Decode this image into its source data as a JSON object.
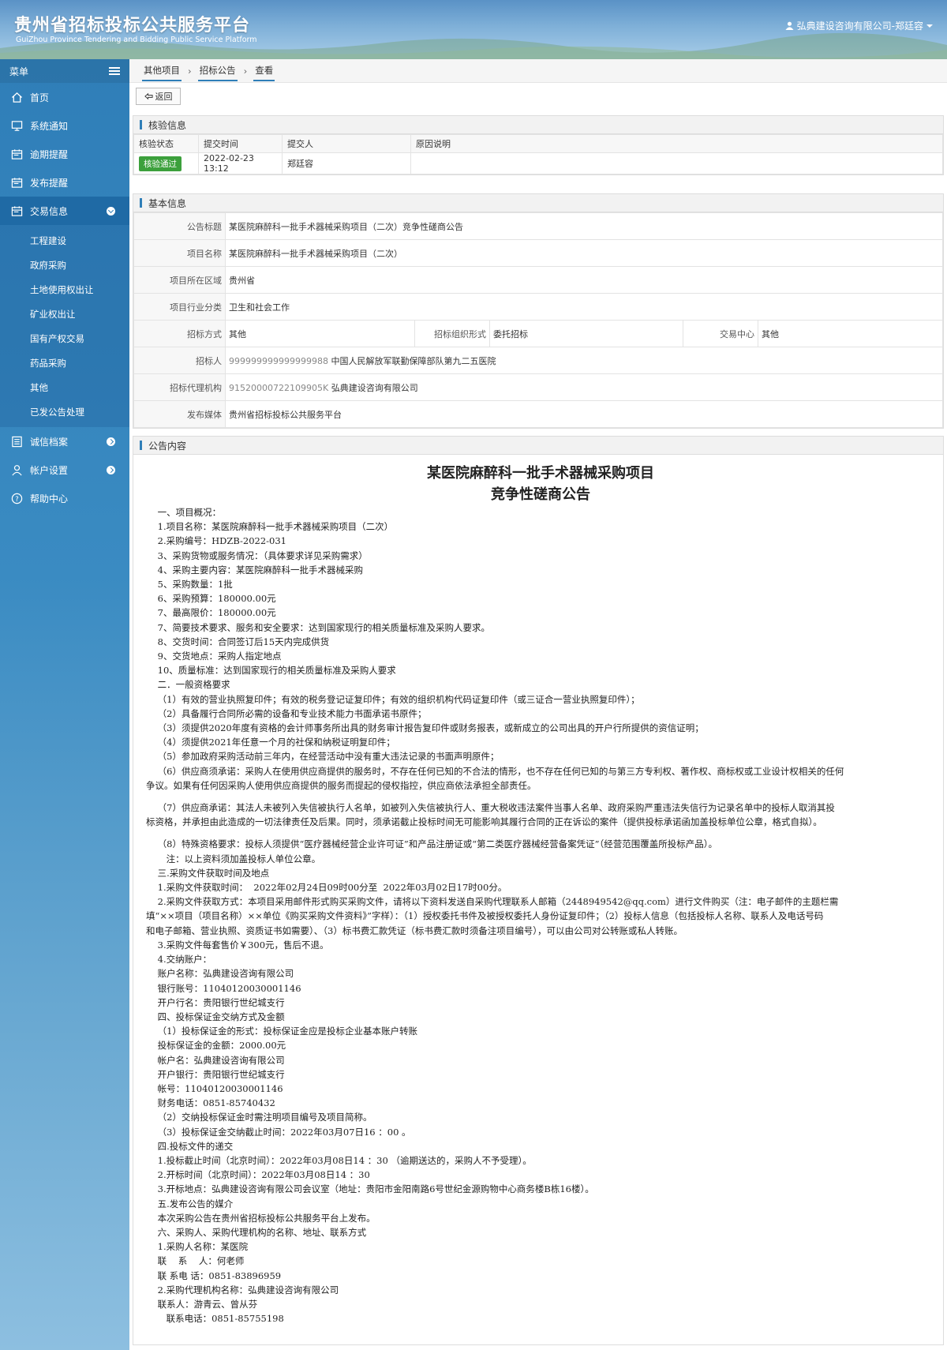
{
  "header": {
    "title_cn": "贵州省招标投标公共服务平台",
    "title_en": "GuiZhou Province Tendering and Bidding Public Service Platform",
    "user": "弘典建设咨询有限公司-郑廷容"
  },
  "sidebar": {
    "menu_label": "菜单",
    "items": [
      {
        "label": "首页"
      },
      {
        "label": "系统通知"
      },
      {
        "label": "逾期提醒"
      },
      {
        "label": "发布提醒"
      },
      {
        "label": "交易信息"
      },
      {
        "label": "诚信档案"
      },
      {
        "label": "帐户设置"
      },
      {
        "label": "帮助中心"
      }
    ],
    "sub_items": [
      "工程建设",
      "政府采购",
      "土地使用权出让",
      "矿业权出让",
      "国有产权交易",
      "药品采购",
      "其他",
      "已发公告处理"
    ]
  },
  "breadcrumb": [
    "其他项目",
    "招标公告",
    "查看"
  ],
  "back_label": "返回",
  "verify": {
    "title": "核验信息",
    "headers": [
      "核验状态",
      "提交时间",
      "提交人",
      "原因说明"
    ],
    "status": "核验通过",
    "time": "2022-02-23 13:12",
    "person": "郑廷容",
    "reason": ""
  },
  "basic": {
    "title": "基本信息",
    "rows": {
      "notice_title_label": "公告标题",
      "notice_title": "某医院麻醉科一批手术器械采购项目（二次）竞争性磋商公告",
      "project_name_label": "项目名称",
      "project_name": "某医院麻醉科一批手术器械采购项目（二次）",
      "region_label": "项目所在区域",
      "region": "贵州省",
      "industry_label": "项目行业分类",
      "industry": "卫生和社会工作",
      "method_label": "招标方式",
      "method": "其他",
      "org_form_label": "招标组织形式",
      "org_form": "委托招标",
      "center_label": "交易中心",
      "center": "其他",
      "tenderer_label": "招标人",
      "tenderer_code": "999999999999999988",
      "tenderer": "中国人民解放军联勤保障部队第九二五医院",
      "agent_label": "招标代理机构",
      "agent_code": "91520000722109905K",
      "agent": "弘典建设咨询有限公司",
      "media_label": "发布媒体",
      "media": "贵州省招标投标公共服务平台"
    }
  },
  "notice": {
    "title": "公告内容",
    "heading1": "某医院麻醉科一批手术器械采购项目",
    "heading2": "竞争性磋商公告",
    "lines": [
      "    一、项目概况：",
      "    1.项目名称：某医院麻醉科一批手术器械采购项目（二次）",
      "    2.采购编号：HDZB-2022-031",
      "    3、采购货物或服务情况：（具体要求详见采购需求）",
      "    4、采购主要内容：某医院麻醉科一批手术器械采购",
      "    5、采购数量：1批",
      "    6、采购预算：180000.00元",
      "    7、最高限价：180000.00元",
      "    7、简要技术要求、服务和安全要求：达到国家现行的相关质量标准及采购人要求。",
      "    8、交货时间：合同签订后15天内完成供货",
      "    9、交货地点：采购人指定地点",
      "    10、质量标准：达到国家现行的相关质量标准及采购人要求",
      "    二．一般资格要求",
      "    （1）有效的营业执照复印件；有效的税务登记证复印件；有效的组织机构代码证复印件（或三证合一营业执照复印件）；",
      "    （2）具备履行合同所必需的设备和专业技术能力书面承诺书原件；",
      "    （3）须提供2020年度有资格的会计师事务所出具的财务审计报告复印件或财务报表，或新成立的公司出具的开户行所提供的资信证明；",
      "    （4）须提供2021年任意一个月的社保和纳税证明复印件；",
      "    （5）参加政府采购活动前三年内，在经营活动中没有重大违法记录的书面声明原件；",
      "    （6）供应商须承诺：采购人在使用供应商提供的服务时，不存在任何已知的不合法的情形，也不存在任何已知的与第三方专利权、著作权、商标权或工业设计权相关的任何",
      "争议。如果有任何因采购人使用供应商提供的服务而提起的侵权指控，供应商依法承担全部责任。",
      "",
      "    （7）供应商承诺：其法人未被列入失信被执行人名单，如被列入失信被执行人、重大税收违法案件当事人名单、政府采购严重违法失信行为记录名单中的投标人取消其投",
      "标资格，并承担由此造成的一切法律责任及后果。同时，须承诺截止投标时间无可能影响其履行合同的正在诉讼的案件（提供投标承诺函加盖投标单位公章，格式自拟）。",
      "",
      "    （8）特殊资格要求：投标人须提供“医疗器械经营企业许可证”和产品注册证或“第二类医疗器械经营备案凭证”（经营范围覆盖所投标产品）。",
      "       注：以上资料须加盖投标人单位公章。",
      "    三.采购文件获取时间及地点",
      "    1.采购文件获取时间：  2022年02月24日09时00分至  2022年03月02日17时00分。",
      "    2.采购文件获取方式：本项目采用邮件形式购买采购文件，请将以下资料发送自采购代理联系人邮箱（2448949542@qq.com）进行文件购买（注：电子邮件的主题栏需",
      "填“××项目（项目名称）××单位《购买采购文件资料》”字样）：（1）授权委托书件及被授权委托人身份证复印件；（2）投标人信息（包括投标人名称、联系人及电话号码",
      "和电子邮箱、营业执照、资质证书如需要）、（3）标书费汇款凭证（标书费汇款时须备注项目编号），可以由公司对公转账或私人转账。",
      "    3.采购文件每套售价￥300元，售后不退。",
      "    4.交纳账户：",
      "    账户名称：弘典建设咨询有限公司",
      "    银行账号：11040120030001146",
      "    开户行名：贵阳银行世纪城支行",
      "    四、投标保证金交纳方式及金额",
      "    （1）投标保证金的形式：投标保证金应是投标企业基本账户转账",
      "    投标保证金的金额：2000.00元",
      "    帐户名：弘典建设咨询有限公司",
      "    开户银行：贵阳银行世纪城支行",
      "    帐号：11040120030001146",
      "    财务电话：0851-85740432",
      "    （2）交纳投标保证金时需注明项目编号及项目简称。",
      "    （3）投标保证金交纳截止时间：2022年03月07日16 ：00 。",
      "    四.投标文件的递交",
      "    1.投标截止时间（北京时间）：2022年03月08日14 ：30 （逾期送达的，采购人不予受理）。",
      "    2.开标时间（北京时间）：2022年03月08日14 ：30",
      "    3.开标地点：弘典建设咨询有限公司会议室（地址：贵阳市金阳南路6号世纪金源购物中心商务楼B栋16楼）。",
      "    五.发布公告的媒介",
      "    本次采购公告在贵州省招标投标公共服务平台上发布。",
      "    六、采购人、采购代理机构的名称、地址、联系方式",
      "    1.采购人名称：某医院",
      "    联    系    人：何老师",
      "    联 系电 话：0851-83896959",
      "    2.采购代理机构名称：弘典建设咨询有限公司",
      "    联系人：游青云、曾从芬",
      "       联系电话：0851-85755198"
    ]
  }
}
